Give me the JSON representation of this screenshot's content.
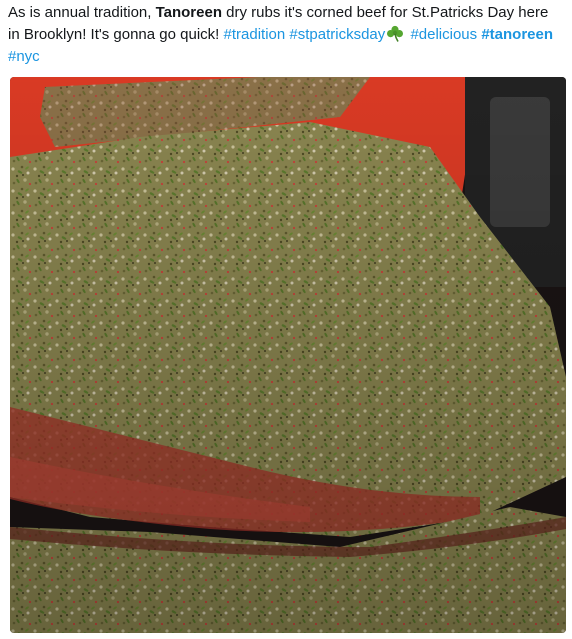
{
  "tweet": {
    "text_part1": "As is annual tradition, ",
    "text_bold_name": "Tanoreen",
    "text_part2": " dry rubs it's corned beef for St.Patricks Day here in Brooklyn! It's gonna go quick! ",
    "hashtags": [
      "#tradition",
      "#stpatricksday",
      "#delicious",
      "#tanoreen",
      "#nyc"
    ],
    "emoji": "shamrock-icon"
  },
  "media": {
    "description_icon": "photo-corned-beef"
  },
  "colors": {
    "hashtag": "#1b95e0",
    "text": "#14171a",
    "board": "#d93a24",
    "herb": "#7e7a45"
  }
}
